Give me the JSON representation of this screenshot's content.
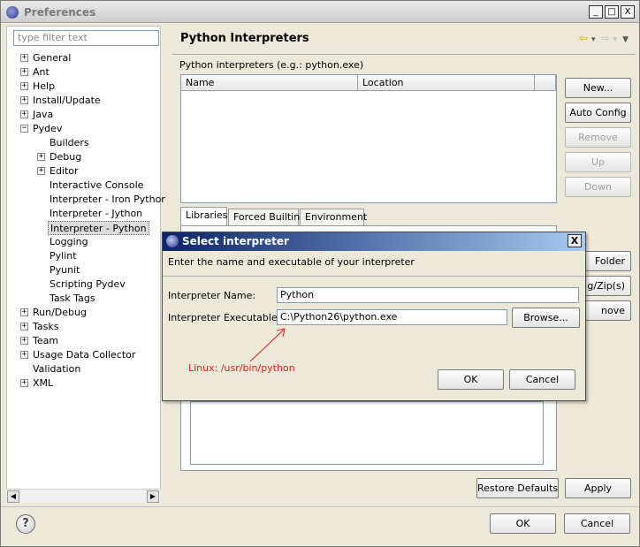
{
  "window": {
    "title": "Preferences",
    "minimize": "_",
    "maximize": "□",
    "close": "X"
  },
  "sidebar": {
    "filter_placeholder": "type filter text",
    "items": [
      {
        "label": "General",
        "expander": "+"
      },
      {
        "label": "Ant",
        "expander": "+"
      },
      {
        "label": "Help",
        "expander": "+"
      },
      {
        "label": "Install/Update",
        "expander": "+"
      },
      {
        "label": "Java",
        "expander": "+"
      },
      {
        "label": "Pydev",
        "expander": "−"
      },
      {
        "label": "Builders"
      },
      {
        "label": "Debug",
        "expander": "+"
      },
      {
        "label": "Editor",
        "expander": "+"
      },
      {
        "label": "Interactive Console"
      },
      {
        "label": "Interpreter - Iron Python"
      },
      {
        "label": "Interpreter - Jython"
      },
      {
        "label": "Interpreter - Python"
      },
      {
        "label": "Logging"
      },
      {
        "label": "Pylint"
      },
      {
        "label": "Pyunit"
      },
      {
        "label": "Scripting Pydev"
      },
      {
        "label": "Task Tags"
      },
      {
        "label": "Run/Debug",
        "expander": "+"
      },
      {
        "label": "Tasks",
        "expander": "+"
      },
      {
        "label": "Team",
        "expander": "+"
      },
      {
        "label": "Usage Data Collector",
        "expander": "+"
      },
      {
        "label": "Validation"
      },
      {
        "label": "XML",
        "expander": "+"
      }
    ],
    "scroll_left": "◀",
    "scroll_right": "▶"
  },
  "main": {
    "title": "Python Interpreters",
    "nav_icons": [
      "back-arrow-icon",
      "dropdown-icon",
      "forward-arrow-icon",
      "dropdown-icon",
      "menu-icon"
    ],
    "nav_glyphs": {
      "back": "⇦",
      "down1": "▾",
      "forward": "⇨",
      "down2": "▾",
      "menu": "▼"
    },
    "subheader": "Python interpreters (e.g.: python.exe)",
    "table_headers": [
      "Name",
      "Location"
    ],
    "buttons": {
      "new": "New...",
      "auto_config": "Auto Config",
      "remove": "Remove",
      "up": "Up",
      "down": "Down"
    },
    "tabs": [
      "Libraries",
      "Forced Builtins",
      "Environment"
    ],
    "side_buttons_partial": [
      "Folder",
      "g/Zip(s)",
      "nove"
    ],
    "restore_defaults": "Restore Defaults",
    "apply": "Apply"
  },
  "dialog": {
    "title": "Select interpreter",
    "close": "X",
    "message": "Enter the name and executable of your interpreter",
    "name_label": "Interpreter Name:",
    "name_value": "Python",
    "exec_label": "Interpreter Executable:",
    "exec_value": "C:\\Python26\\python.exe",
    "browse": "Browse...",
    "hint": "Linux: /usr/bin/python",
    "ok": "OK",
    "cancel": "Cancel"
  },
  "footer": {
    "help": "?",
    "ok": "OK",
    "cancel": "Cancel"
  }
}
